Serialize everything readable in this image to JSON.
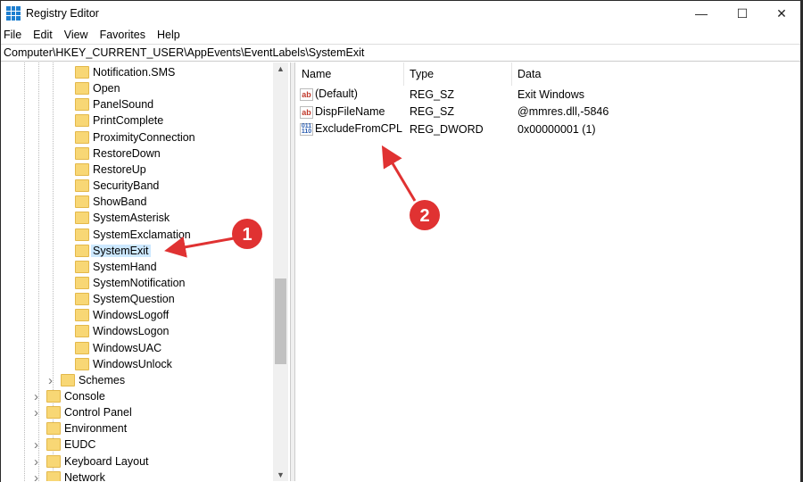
{
  "window": {
    "title": "Registry Editor",
    "minimize": "—",
    "maximize": "☐",
    "close": "✕"
  },
  "menu": [
    "File",
    "Edit",
    "View",
    "Favorites",
    "Help"
  ],
  "address": "Computer\\HKEY_CURRENT_USER\\AppEvents\\EventLabels\\SystemExit",
  "tree": {
    "level3": [
      "Notification.SMS",
      "Open",
      "PanelSound",
      "PrintComplete",
      "ProximityConnection",
      "RestoreDown",
      "RestoreUp",
      "SecurityBand",
      "ShowBand",
      "SystemAsterisk",
      "SystemExclamation",
      "SystemExit",
      "SystemHand",
      "SystemNotification",
      "SystemQuestion",
      "WindowsLogoff",
      "WindowsLogon",
      "WindowsUAC",
      "WindowsUnlock"
    ],
    "selected": "SystemExit",
    "level2": [
      "Schemes"
    ],
    "level1": [
      "Console",
      "Control Panel",
      "Environment",
      "EUDC",
      "Keyboard Layout",
      "Network"
    ]
  },
  "list": {
    "headers": [
      "Name",
      "Type",
      "Data"
    ],
    "rows": [
      {
        "icon": "ab",
        "name": "(Default)",
        "type": "REG_SZ",
        "data": "Exit Windows"
      },
      {
        "icon": "ab",
        "name": "DispFileName",
        "type": "REG_SZ",
        "data": "@mmres.dll,-5846"
      },
      {
        "icon": "011\n110",
        "name": "ExcludeFromCPL",
        "type": "REG_DWORD",
        "data": "0x00000001 (1)"
      }
    ]
  },
  "annotations": [
    "1",
    "2"
  ],
  "colors": {
    "annotation": "#e03232",
    "selection": "#cce8ff",
    "folder": "#f8d775"
  }
}
